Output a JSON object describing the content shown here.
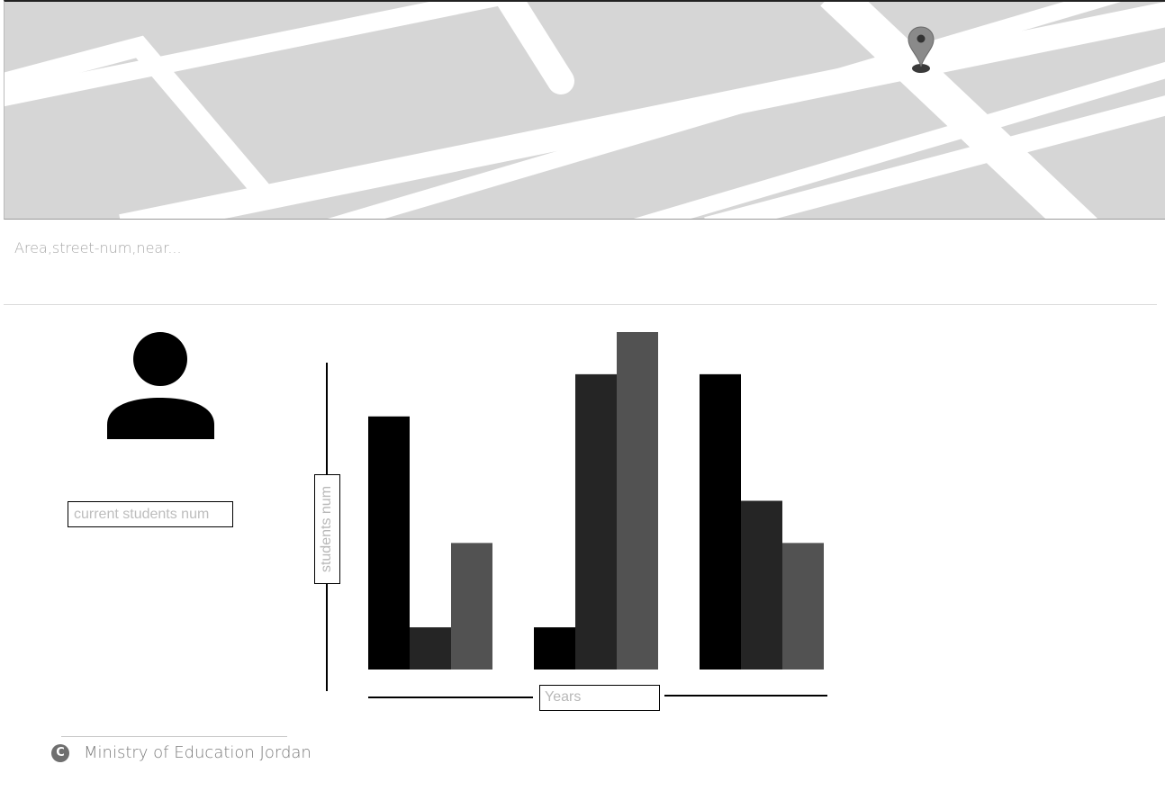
{
  "map": {
    "background_color": "#d6d6d6",
    "road_color": "#ffffff",
    "marker_icon": "map-marker-icon"
  },
  "address": {
    "placeholder": "Area,street-num,near..."
  },
  "profile": {
    "avatar_icon": "user-icon",
    "students_placeholder": "current students num"
  },
  "chart_data": {
    "type": "bar",
    "categories": [
      "",
      "",
      ""
    ],
    "series": [
      {
        "color": "#000000",
        "values": [
          6,
          1,
          7
        ]
      },
      {
        "color": "#252525",
        "values": [
          1,
          7,
          4
        ]
      },
      {
        "color": "#525252",
        "values": [
          3,
          8,
          3
        ]
      }
    ],
    "ylabel": "students num",
    "xlabel": "Years",
    "ylim": [
      0,
      8
    ],
    "grid": false,
    "legend": "none"
  },
  "footer": {
    "icon": "copyright-icon",
    "copyright_symbol": "C",
    "text": "Ministry of Education Jordan"
  }
}
